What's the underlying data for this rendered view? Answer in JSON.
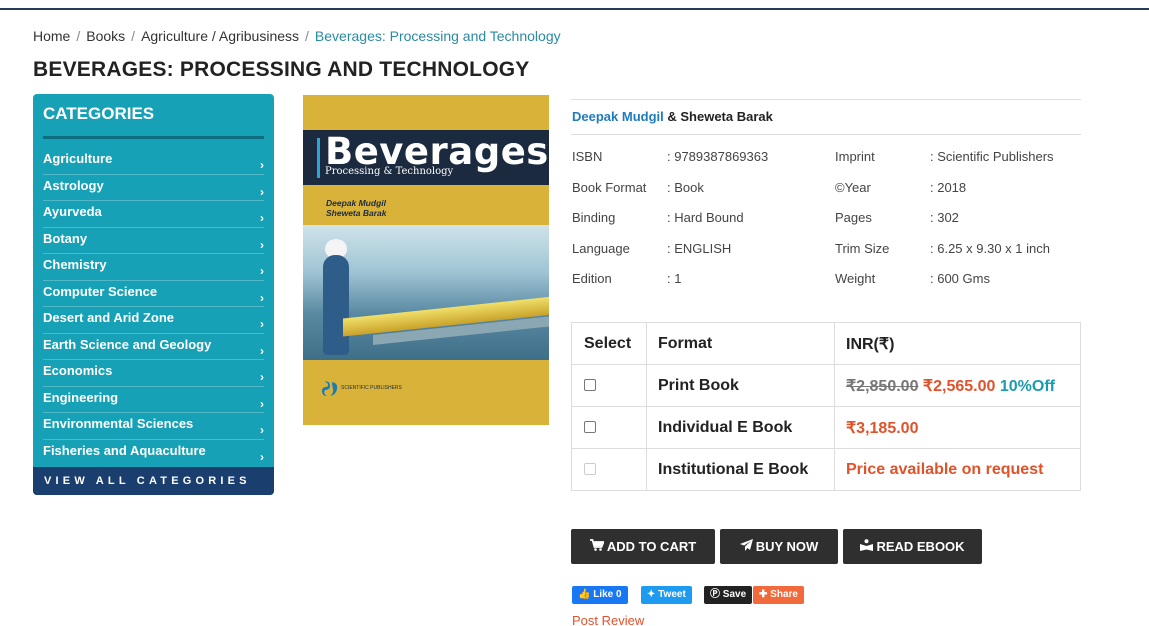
{
  "breadcrumb": {
    "items": [
      "Home",
      "Books",
      "Agriculture / Agribusiness"
    ],
    "current": "Beverages: Processing and Technology"
  },
  "page_title": "BEVERAGES: PROCESSING AND TECHNOLOGY",
  "sidebar": {
    "heading": "CATEGORIES",
    "items": [
      {
        "label": "Agriculture"
      },
      {
        "label": "Astrology"
      },
      {
        "label": "Ayurveda"
      },
      {
        "label": "Botany"
      },
      {
        "label": "Chemistry"
      },
      {
        "label": "Computer Science"
      },
      {
        "label": "Desert and Arid Zone"
      },
      {
        "label": "Earth Science and Geology"
      },
      {
        "label": "Economics"
      },
      {
        "label": "Engineering"
      },
      {
        "label": "Environmental Sciences"
      },
      {
        "label": "Fisheries and Aquaculture"
      }
    ],
    "chevron": "›",
    "view_all": "VIEW ALL CATEGORIES"
  },
  "cover": {
    "title": "Beverages",
    "subtitle": "Processing & Technology",
    "author1": "Deepak Mudgil",
    "author2": "Sheweta Barak",
    "publisher": "SCIENTIFIC PUBLISHERS"
  },
  "authors": {
    "first": "Deepak Mudgil",
    "rest": " & Sheweta Barak"
  },
  "meta_left": [
    {
      "label": "ISBN",
      "value": ": 9789387869363"
    },
    {
      "label": "Book Format",
      "value": ": Book"
    },
    {
      "label": "Binding",
      "value": ": Hard Bound"
    },
    {
      "label": "Language",
      "value": ": ENGLISH"
    },
    {
      "label": "Edition",
      "value": ": 1"
    }
  ],
  "meta_right": [
    {
      "label": "Imprint",
      "value": ": Scientific Publishers"
    },
    {
      "label": "©Year",
      "value": ": 2018"
    },
    {
      "label": "Pages",
      "value": ": 302"
    },
    {
      "label": "Trim Size",
      "value": ": 6.25 x 9.30 x 1 inch"
    },
    {
      "label": "Weight",
      "value": ": 600 Gms"
    }
  ],
  "price_table": {
    "headers": {
      "select": "Select",
      "format": "Format",
      "price": "INR(₹)"
    },
    "rows": [
      {
        "format": "Print Book",
        "old_price": "₹2,850.00",
        "price": "₹2,565.00",
        "discount": "10%Off"
      },
      {
        "format": "Individual E Book",
        "price": "₹3,185.00"
      },
      {
        "format": "Institutional E Book",
        "price": "Price available on request"
      }
    ]
  },
  "buttons": {
    "add_to_cart": "ADD TO CART",
    "buy_now": "BUY NOW",
    "read_ebook": "READ EBOOK"
  },
  "share": {
    "like": "Like 0",
    "tweet": "Tweet",
    "save": "Save",
    "share": "Share"
  },
  "post_review": "Post Review",
  "colors": {
    "sidebar_bg": "#17a1b6",
    "view_all_bg": "#1a3e6e",
    "price": "#e0532a",
    "discount": "#1a9bb0",
    "link": "#1f7bc0",
    "button_bg": "#2f2f2f"
  }
}
